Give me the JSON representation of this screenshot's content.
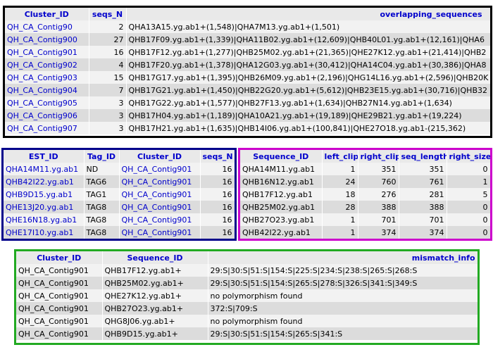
{
  "clusters": {
    "headers": [
      "Cluster_ID",
      "seqs_N",
      "overlapping_sequences"
    ],
    "rows": [
      [
        "QH_CA_Contig90",
        "2",
        "QHA13A15.yg.ab1+(1,548)|QHA7M13.yg.ab1+(1,501)"
      ],
      [
        "QH_CA_Contig900",
        "27",
        "QHB17F09.yg.ab1+(1,339)|QHA11B02.yg.ab1+(12,609)|QHB40L01.yg.ab1+(12,161)|QHA6"
      ],
      [
        "QH_CA_Contig901",
        "16",
        "QHB17F12.yg.ab1+(1,277)|QHB25M02.yg.ab1+(21,365)|QHE27K12.yg.ab1+(21,414)|QHB2"
      ],
      [
        "QH_CA_Contig902",
        "4",
        "QHB17F20.yg.ab1+(1,378)|QHA12G03.yg.ab1+(30,412)|QHA14C04.yg.ab1+(30,386)|QHA8"
      ],
      [
        "QH_CA_Contig903",
        "15",
        "QHB17G17.yg.ab1+(1,395)|QHB26M09.yg.ab1+(2,196)|QHG14L16.yg.ab1+(2,596)|QHB20K"
      ],
      [
        "QH_CA_Contig904",
        "7",
        "QHB17G21.yg.ab1+(1,450)|QHB22G20.yg.ab1+(5,612)|QHB23E15.yg.ab1+(30,716)|QHB32"
      ],
      [
        "QH_CA_Contig905",
        "3",
        "QHB17G22.yg.ab1+(1,577)|QHB27F13.yg.ab1+(1,634)|QHB27N14.yg.ab1+(1,634)"
      ],
      [
        "QH_CA_Contig906",
        "3",
        "QHB17H04.yg.ab1+(1,189)|QHA10A21.yg.ab1+(19,189)|QHE29B21.yg.ab1+(19,224)"
      ],
      [
        "QH_CA_Contig907",
        "3",
        "QHB17H21.yg.ab1+(1,635)|QHB14I06.yg.ab1+(100,841)|QHE27O18.yg.ab1-(215,362)"
      ]
    ]
  },
  "ests": {
    "headers": [
      "EST_ID",
      "Tag_ID",
      "Cluster_ID",
      "seqs_N"
    ],
    "rows": [
      [
        "QHA14M11.yg.ab1",
        "ND",
        "QH_CA_Contig901",
        "16"
      ],
      [
        "QHB42I22.yg.ab1",
        "TAG6",
        "QH_CA_Contig901",
        "16"
      ],
      [
        "QHB9D15.yg.ab1",
        "TAG1",
        "QH_CA_Contig901",
        "16"
      ],
      [
        "QHE13J20.yg.ab1",
        "TAG8",
        "QH_CA_Contig901",
        "16"
      ],
      [
        "QHE16N18.yg.ab1",
        "TAG8",
        "QH_CA_Contig901",
        "16"
      ],
      [
        "QHE17I10.yg.ab1",
        "TAG8",
        "QH_CA_Contig901",
        "16"
      ]
    ]
  },
  "sequences": {
    "headers": [
      "Sequence_ID",
      "left_clip",
      "right_clip",
      "seq_length",
      "right_size"
    ],
    "rows": [
      [
        "QHA14M11.yg.ab1",
        "1",
        "351",
        "351",
        "0"
      ],
      [
        "QHB16N12.yg.ab1",
        "24",
        "760",
        "761",
        "1"
      ],
      [
        "QHB17F12.yg.ab1",
        "18",
        "276",
        "281",
        "5"
      ],
      [
        "QHB25M02.yg.ab1",
        "28",
        "388",
        "388",
        "0"
      ],
      [
        "QHB27O23.yg.ab1",
        "1",
        "701",
        "701",
        "0"
      ],
      [
        "QHB42I22.yg.ab1",
        "1",
        "374",
        "374",
        "0"
      ]
    ]
  },
  "mismatch": {
    "headers": [
      "Cluster_ID",
      "Sequence_ID",
      "mismatch_info"
    ],
    "rows": [
      [
        "QH_CA_Contig901",
        "QHB17F12.yg.ab1+",
        "29:S|30:S|51:S|154:S|225:S|234:S|238:S|265:S|268:S"
      ],
      [
        "QH_CA_Contig901",
        "QHB25M02.yg.ab1+",
        "29:S|30:S|51:S|154:S|265:S|278:S|326:S|341:S|349:S"
      ],
      [
        "QH_CA_Contig901",
        "QHE27K12.yg.ab1+",
        "no polymorphism found"
      ],
      [
        "QH_CA_Contig901",
        "QHB27O23.yg.ab1+",
        "372:S|709:S"
      ],
      [
        "QH_CA_Contig901",
        "QHG8J06.yg.ab1+",
        "no polymorphism found"
      ],
      [
        "QH_CA_Contig901",
        "QHB9D15.yg.ab1+",
        "29:S|30:S|51:S|154:S|265:S|341:S"
      ]
    ]
  },
  "colors": {
    "clusters_border": "#000000",
    "ests_border": "#00008b",
    "sequences_border": "#cc00cc",
    "mismatch_border": "#22aa22",
    "header_text": "#0000cc",
    "link_text": "#0000cc"
  }
}
